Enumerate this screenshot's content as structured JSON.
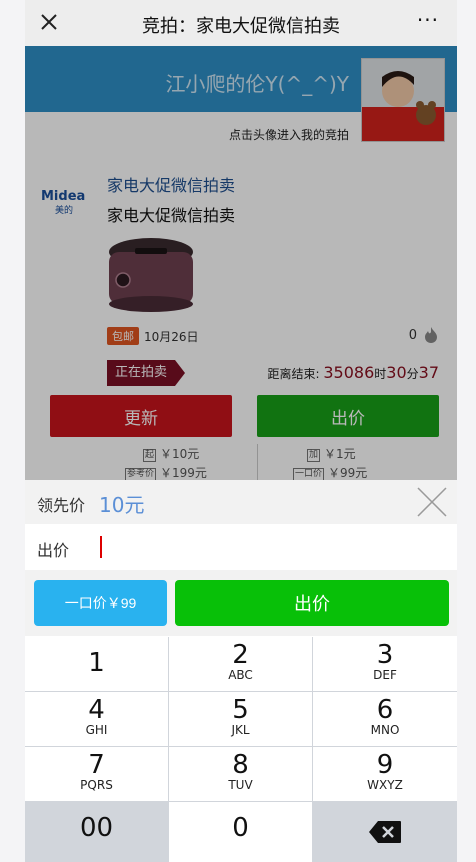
{
  "nav": {
    "title": "竞拍：家电大促微信拍卖",
    "more": "···"
  },
  "banner": {
    "username": "江小爬的伦Y(^_^)Y",
    "hint": "点击头像进入我的竞拍"
  },
  "item": {
    "brand_text": "Midea",
    "brand_sub": "美的",
    "title_link": "家电大促微信拍卖",
    "title": "家电大促微信拍卖",
    "shipping_badge": "包邮",
    "date": "10月26日",
    "watch_count": "0",
    "status": "正在拍卖",
    "countdown_label": "距离结束:",
    "countdown_seconds": "35086",
    "unit_h": "时",
    "countdown_minutes": "30",
    "unit_m": "分",
    "countdown_s": "37"
  },
  "actions": {
    "refresh": "更新",
    "bid": "出价"
  },
  "prices": {
    "start_icon": "起",
    "start": "￥10元",
    "increment_icon": "加",
    "increment": "￥1元",
    "reference_icon": "参考价",
    "reference": "￥199元",
    "buynow_icon": "一口价",
    "buynow": "￥99元"
  },
  "panel": {
    "lead_label": "领先价",
    "lead_value": "10元",
    "bid_label": "出价",
    "buynow_button": "一口价￥99",
    "bid_button": "出价"
  },
  "keypad": [
    {
      "digit": "1",
      "letters": ""
    },
    {
      "digit": "2",
      "letters": "ABC"
    },
    {
      "digit": "3",
      "letters": "DEF"
    },
    {
      "digit": "4",
      "letters": "GHI"
    },
    {
      "digit": "5",
      "letters": "JKL"
    },
    {
      "digit": "6",
      "letters": "MNO"
    },
    {
      "digit": "7",
      "letters": "PQRS"
    },
    {
      "digit": "8",
      "letters": "TUV"
    },
    {
      "digit": "9",
      "letters": "WXYZ"
    },
    {
      "digit": "00",
      "letters": ""
    },
    {
      "digit": "0",
      "letters": ""
    }
  ],
  "icons": {
    "close": "close-icon",
    "more": "more-icon",
    "fire": "fire-icon",
    "panel_close": "close-icon",
    "backspace": "backspace-icon",
    "avatar": "avatar-photo",
    "product": "rice-cooker-image",
    "brand": "midea-logo"
  },
  "colors": {
    "banner": "#2e8fc7",
    "refresh": "#c8141c",
    "bid": "#18a018",
    "buynow": "#29b2ef",
    "bid_panel": "#08c008",
    "status": "#7b1025"
  }
}
